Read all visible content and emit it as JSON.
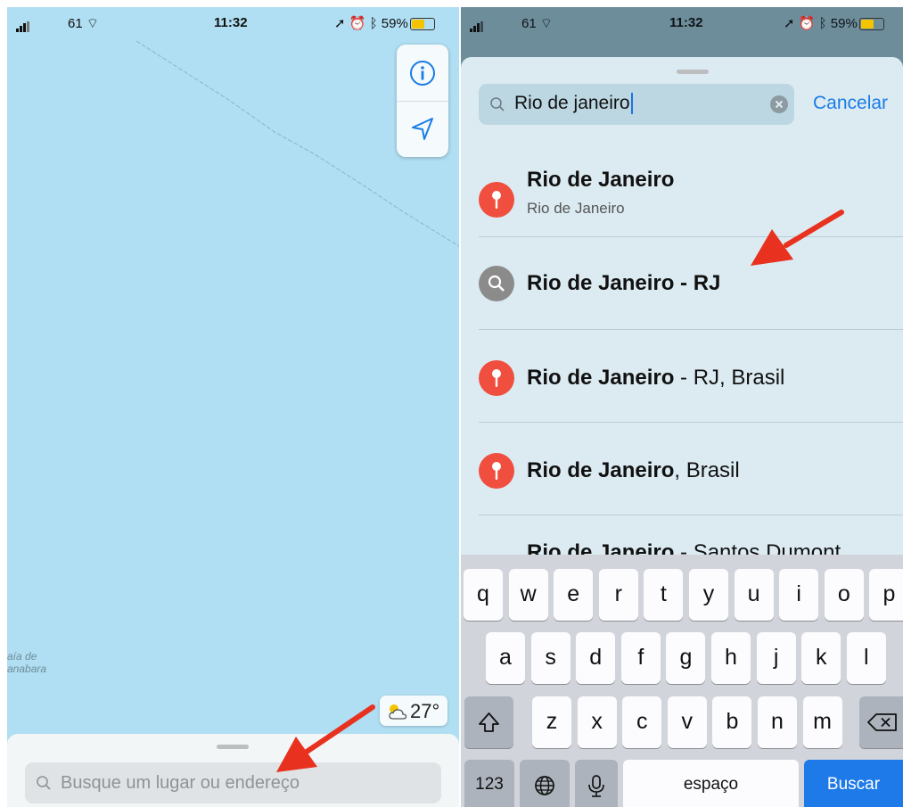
{
  "left_screen": {
    "status": {
      "signal": "61",
      "time": "11:32",
      "battery": "59%"
    },
    "map": {
      "place_label_line1": "aía de",
      "place_label_line2": "anabara"
    },
    "weather": {
      "temperature": "27°",
      "icon": "partly-cloudy-icon"
    },
    "search": {
      "placeholder": "Busque um lugar ou endereço"
    },
    "controls": {
      "info_icon": "info-icon",
      "location_icon": "location-arrow-icon"
    }
  },
  "right_screen": {
    "status": {
      "signal": "61",
      "time": "11:32",
      "battery": "59%"
    },
    "search": {
      "value": "Rio de janeiro",
      "cancel_label": "Cancelar"
    },
    "results": [
      {
        "bold": "Rio de Janeiro",
        "rest": "",
        "subtitle": "Rio de Janeiro",
        "icon": "pin-icon"
      },
      {
        "bold": "Rio de Janeiro - RJ",
        "rest": "",
        "subtitle": "",
        "icon": "search-icon"
      },
      {
        "bold": "Rio de Janeiro",
        "rest": " - RJ, Brasil",
        "subtitle": "",
        "icon": "pin-icon"
      },
      {
        "bold": "Rio de Janeiro",
        "rest": ", Brasil",
        "subtitle": "",
        "icon": "pin-icon"
      },
      {
        "bold": "Rio de Janeiro",
        "rest": " - Santos Dumont",
        "subtitle": "",
        "icon": "pin-icon"
      }
    ],
    "keyboard": {
      "row1": [
        "q",
        "w",
        "e",
        "r",
        "t",
        "y",
        "u",
        "i",
        "o",
        "p"
      ],
      "row2": [
        "a",
        "s",
        "d",
        "f",
        "g",
        "h",
        "j",
        "k",
        "l"
      ],
      "row3": [
        "z",
        "x",
        "c",
        "v",
        "b",
        "n",
        "m"
      ],
      "numbers_label": "123",
      "space_label": "espaço",
      "return_label": "Buscar"
    }
  },
  "colors": {
    "map_water": "#b0def2",
    "accent_blue": "#1a7ce6",
    "pin_red": "#f04e3e",
    "arrow_red": "#e8321f"
  }
}
